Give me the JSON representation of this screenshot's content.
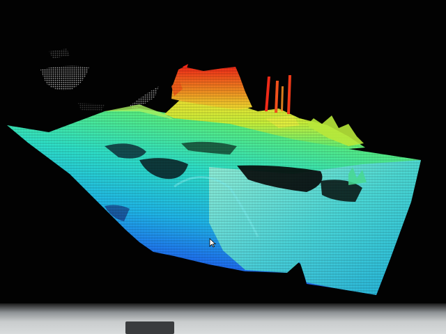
{
  "scene": {
    "type": "3d-point-cloud",
    "colormap": [
      "#2a10d8",
      "#1e5cf0",
      "#1fb6e8",
      "#2ee0c8",
      "#5cf07a",
      "#c8f03a",
      "#f0e030",
      "#f08a20",
      "#f02a18"
    ]
  },
  "colors": {
    "background": "#020202",
    "bezel": "#c9cccd"
  },
  "icons": {
    "cursor": "mouse-pointer-icon"
  }
}
